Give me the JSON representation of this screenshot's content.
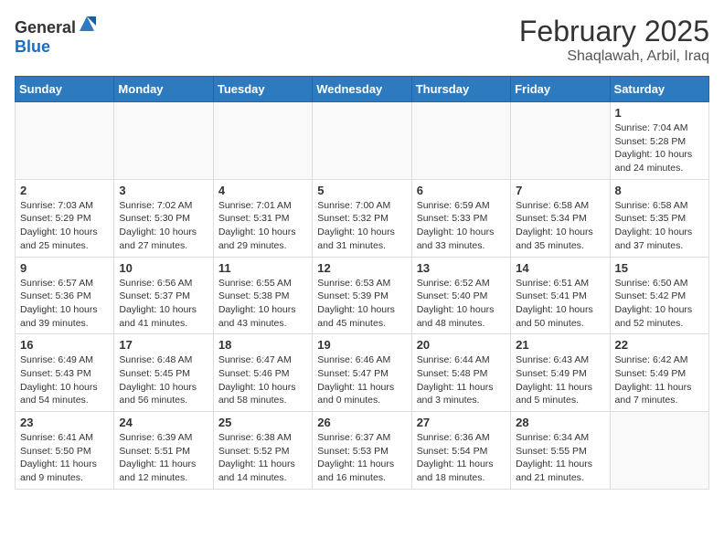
{
  "header": {
    "logo_general": "General",
    "logo_blue": "Blue",
    "title": "February 2025",
    "subtitle": "Shaqlawah, Arbil, Iraq"
  },
  "weekdays": [
    "Sunday",
    "Monday",
    "Tuesday",
    "Wednesday",
    "Thursday",
    "Friday",
    "Saturday"
  ],
  "weeks": [
    [
      {
        "day": "",
        "info": ""
      },
      {
        "day": "",
        "info": ""
      },
      {
        "day": "",
        "info": ""
      },
      {
        "day": "",
        "info": ""
      },
      {
        "day": "",
        "info": ""
      },
      {
        "day": "",
        "info": ""
      },
      {
        "day": "1",
        "info": "Sunrise: 7:04 AM\nSunset: 5:28 PM\nDaylight: 10 hours\nand 24 minutes."
      }
    ],
    [
      {
        "day": "2",
        "info": "Sunrise: 7:03 AM\nSunset: 5:29 PM\nDaylight: 10 hours\nand 25 minutes."
      },
      {
        "day": "3",
        "info": "Sunrise: 7:02 AM\nSunset: 5:30 PM\nDaylight: 10 hours\nand 27 minutes."
      },
      {
        "day": "4",
        "info": "Sunrise: 7:01 AM\nSunset: 5:31 PM\nDaylight: 10 hours\nand 29 minutes."
      },
      {
        "day": "5",
        "info": "Sunrise: 7:00 AM\nSunset: 5:32 PM\nDaylight: 10 hours\nand 31 minutes."
      },
      {
        "day": "6",
        "info": "Sunrise: 6:59 AM\nSunset: 5:33 PM\nDaylight: 10 hours\nand 33 minutes."
      },
      {
        "day": "7",
        "info": "Sunrise: 6:58 AM\nSunset: 5:34 PM\nDaylight: 10 hours\nand 35 minutes."
      },
      {
        "day": "8",
        "info": "Sunrise: 6:58 AM\nSunset: 5:35 PM\nDaylight: 10 hours\nand 37 minutes."
      }
    ],
    [
      {
        "day": "9",
        "info": "Sunrise: 6:57 AM\nSunset: 5:36 PM\nDaylight: 10 hours\nand 39 minutes."
      },
      {
        "day": "10",
        "info": "Sunrise: 6:56 AM\nSunset: 5:37 PM\nDaylight: 10 hours\nand 41 minutes."
      },
      {
        "day": "11",
        "info": "Sunrise: 6:55 AM\nSunset: 5:38 PM\nDaylight: 10 hours\nand 43 minutes."
      },
      {
        "day": "12",
        "info": "Sunrise: 6:53 AM\nSunset: 5:39 PM\nDaylight: 10 hours\nand 45 minutes."
      },
      {
        "day": "13",
        "info": "Sunrise: 6:52 AM\nSunset: 5:40 PM\nDaylight: 10 hours\nand 48 minutes."
      },
      {
        "day": "14",
        "info": "Sunrise: 6:51 AM\nSunset: 5:41 PM\nDaylight: 10 hours\nand 50 minutes."
      },
      {
        "day": "15",
        "info": "Sunrise: 6:50 AM\nSunset: 5:42 PM\nDaylight: 10 hours\nand 52 minutes."
      }
    ],
    [
      {
        "day": "16",
        "info": "Sunrise: 6:49 AM\nSunset: 5:43 PM\nDaylight: 10 hours\nand 54 minutes."
      },
      {
        "day": "17",
        "info": "Sunrise: 6:48 AM\nSunset: 5:45 PM\nDaylight: 10 hours\nand 56 minutes."
      },
      {
        "day": "18",
        "info": "Sunrise: 6:47 AM\nSunset: 5:46 PM\nDaylight: 10 hours\nand 58 minutes."
      },
      {
        "day": "19",
        "info": "Sunrise: 6:46 AM\nSunset: 5:47 PM\nDaylight: 11 hours\nand 0 minutes."
      },
      {
        "day": "20",
        "info": "Sunrise: 6:44 AM\nSunset: 5:48 PM\nDaylight: 11 hours\nand 3 minutes."
      },
      {
        "day": "21",
        "info": "Sunrise: 6:43 AM\nSunset: 5:49 PM\nDaylight: 11 hours\nand 5 minutes."
      },
      {
        "day": "22",
        "info": "Sunrise: 6:42 AM\nSunset: 5:49 PM\nDaylight: 11 hours\nand 7 minutes."
      }
    ],
    [
      {
        "day": "23",
        "info": "Sunrise: 6:41 AM\nSunset: 5:50 PM\nDaylight: 11 hours\nand 9 minutes."
      },
      {
        "day": "24",
        "info": "Sunrise: 6:39 AM\nSunset: 5:51 PM\nDaylight: 11 hours\nand 12 minutes."
      },
      {
        "day": "25",
        "info": "Sunrise: 6:38 AM\nSunset: 5:52 PM\nDaylight: 11 hours\nand 14 minutes."
      },
      {
        "day": "26",
        "info": "Sunrise: 6:37 AM\nSunset: 5:53 PM\nDaylight: 11 hours\nand 16 minutes."
      },
      {
        "day": "27",
        "info": "Sunrise: 6:36 AM\nSunset: 5:54 PM\nDaylight: 11 hours\nand 18 minutes."
      },
      {
        "day": "28",
        "info": "Sunrise: 6:34 AM\nSunset: 5:55 PM\nDaylight: 11 hours\nand 21 minutes."
      },
      {
        "day": "",
        "info": ""
      }
    ]
  ]
}
